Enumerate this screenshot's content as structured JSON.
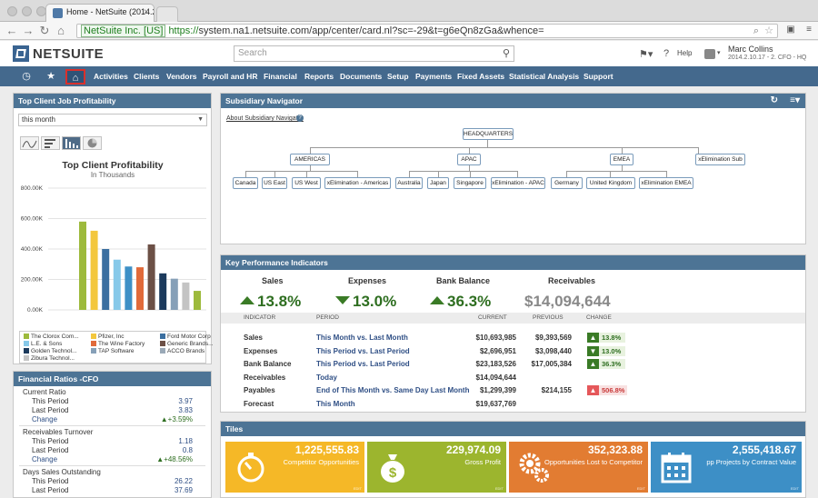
{
  "browser": {
    "tab_title": "Home - NetSuite (2014.2.1",
    "url_ev": "NetSuite Inc. [US]",
    "url_scheme": "https://",
    "url_rest": "system.na1.netsuite.com/app/center/card.nl?sc=-29&t=g6eQn8zGa&whence="
  },
  "header": {
    "logo": "NETSUITE",
    "search_placeholder": "Search",
    "help": "Help",
    "user_name": "Marc Collins",
    "user_role": "2014.2.10.17 - 2. CFO - HQ"
  },
  "nav": {
    "items": [
      "Activities",
      "Clients",
      "Vendors",
      "Payroll and HR",
      "Financial",
      "Reports",
      "Documents",
      "Setup",
      "Payments",
      "Fixed Assets",
      "Statistical Analysis",
      "Support"
    ]
  },
  "top_client": {
    "title": "Top Client Job Profitability",
    "period": "this month",
    "chart_title": "Top Client Profitability",
    "chart_sub": "In Thousands"
  },
  "chart_data": {
    "type": "bar",
    "title": "Top Client Profitability",
    "subtitle": "In Thousands",
    "categories": [
      "The Clorox Com...",
      "L.E. & Sons",
      "Golden Technol...",
      "Zibura Technol...",
      "Pfizer, Inc",
      "The Wine Factory",
      "TAP Software",
      "Ford Motor Corp",
      "Generic Brands...",
      "ACCO Brands"
    ],
    "values": [
      580000,
      520000,
      400000,
      330000,
      285000,
      280000,
      430000,
      240000,
      205000,
      180000,
      125000
    ],
    "colors": [
      "#9dba3c",
      "#f3c73d",
      "#3b6fa0",
      "#87c9e9",
      "#3e90c6",
      "#e16a3a",
      "#6c5046",
      "#1c3a5c",
      "#86a0b8",
      "#c4c4c4"
    ],
    "yticks": [
      "0.00K",
      "200.00K",
      "400.00K",
      "600.00K",
      "800.00K"
    ],
    "ylim": [
      0,
      800000
    ]
  },
  "legend": [
    {
      "label": "The Clorox Com...",
      "color": "#9dba3c"
    },
    {
      "label": "L.E. & Sons",
      "color": "#87c9e9"
    },
    {
      "label": "Golden Technol...",
      "color": "#1c3a5c"
    },
    {
      "label": "Zibura Technol...",
      "color": "#c4c4c4"
    },
    {
      "label": "Pfizer, Inc",
      "color": "#f3c73d"
    },
    {
      "label": "The Wine Factory",
      "color": "#e16a3a"
    },
    {
      "label": "TAP Software",
      "color": "#86a0b8"
    },
    {
      "label": "Ford Motor Corp",
      "color": "#3b6fa0"
    },
    {
      "label": "Generic Brands...",
      "color": "#6c5046"
    },
    {
      "label": "ACCO Brands",
      "color": "#9aa9b7"
    }
  ],
  "ratios": {
    "title": "Financial Ratios -CFO",
    "groups": [
      {
        "name": "Current Ratio",
        "this_label": "This Period",
        "this_val": "3.97",
        "last_label": "Last Period",
        "last_val": "3.83",
        "chg_label": "Change",
        "chg_val": "+3.59%"
      },
      {
        "name": "Receivables Turnover",
        "this_label": "This Period",
        "this_val": "1.18",
        "last_label": "Last Period",
        "last_val": "0.8",
        "chg_label": "Change",
        "chg_val": "+48.56%"
      },
      {
        "name": "Days Sales Outstanding",
        "this_label": "This Period",
        "this_val": "26.22",
        "last_label": "Last Period",
        "last_val": "37.69"
      }
    ]
  },
  "subsidiary": {
    "title": "Subsidiary Navigator",
    "about": "About Subsidiary Navigator",
    "root": "HEADQUARTERS",
    "level1": [
      "AMERICAS",
      "APAC",
      "EMEA",
      "xElimination Sub"
    ],
    "americas": [
      "Canada",
      "US East",
      "US West",
      "xElimination - Americas"
    ],
    "apac": [
      "Australia",
      "Japan",
      "Singapore",
      "xElimination - APAC"
    ],
    "emea": [
      "Germany",
      "United Kingdom",
      "xElimination EMEA"
    ]
  },
  "kpi": {
    "title": "Key Performance Indicators",
    "summary": [
      {
        "label": "Sales",
        "value": "13.8%",
        "dir": "up"
      },
      {
        "label": "Expenses",
        "value": "13.0%",
        "dir": "down"
      },
      {
        "label": "Bank Balance",
        "value": "36.3%",
        "dir": "up"
      },
      {
        "label": "Receivables",
        "value": "$14,094,644",
        "dir": "none"
      }
    ],
    "headers": [
      "INDICATOR",
      "PERIOD",
      "CURRENT",
      "PREVIOUS",
      "CHANGE"
    ],
    "rows": [
      {
        "indicator": "Sales",
        "period": "This Month vs. Last Month",
        "current": "$10,693,985",
        "previous": "$9,393,569",
        "change": "13.8%",
        "dir": "up"
      },
      {
        "indicator": "Expenses",
        "period": "This Period vs. Last Period",
        "current": "$2,696,951",
        "previous": "$3,098,440",
        "change": "13.0%",
        "dir": "down-good"
      },
      {
        "indicator": "Bank Balance",
        "period": "This Period vs. Last Period",
        "current": "$23,183,526",
        "previous": "$17,005,384",
        "change": "36.3%",
        "dir": "up"
      },
      {
        "indicator": "Receivables",
        "period": "Today",
        "current": "$14,094,644",
        "previous": "",
        "change": "",
        "dir": ""
      },
      {
        "indicator": "Payables",
        "period": "End of This Month vs. Same Day Last Month",
        "current": "$1,299,399",
        "previous": "$214,155",
        "change": "506.8%",
        "dir": "bad"
      },
      {
        "indicator": "Forecast",
        "period": "This Month",
        "current": "$19,637,769",
        "previous": "",
        "change": "",
        "dir": ""
      }
    ]
  },
  "tiles": {
    "title": "Tiles",
    "items": [
      {
        "value": "1,225,555.83",
        "label": "Competitor Opportunities",
        "color": "#f5b827",
        "edit": "EDIT"
      },
      {
        "value": "229,974.09",
        "label": "Gross Profit",
        "color": "#9cb52e",
        "edit": "EDIT"
      },
      {
        "value": "352,323.88",
        "label": "Opportunities Lost to Competitor",
        "color": "#e27c32",
        "edit": "EDIT"
      },
      {
        "value": "2,555,418.67",
        "label": "pp Projects by Contract Value",
        "color": "#3d8fc6",
        "edit": "EDIT"
      }
    ]
  }
}
